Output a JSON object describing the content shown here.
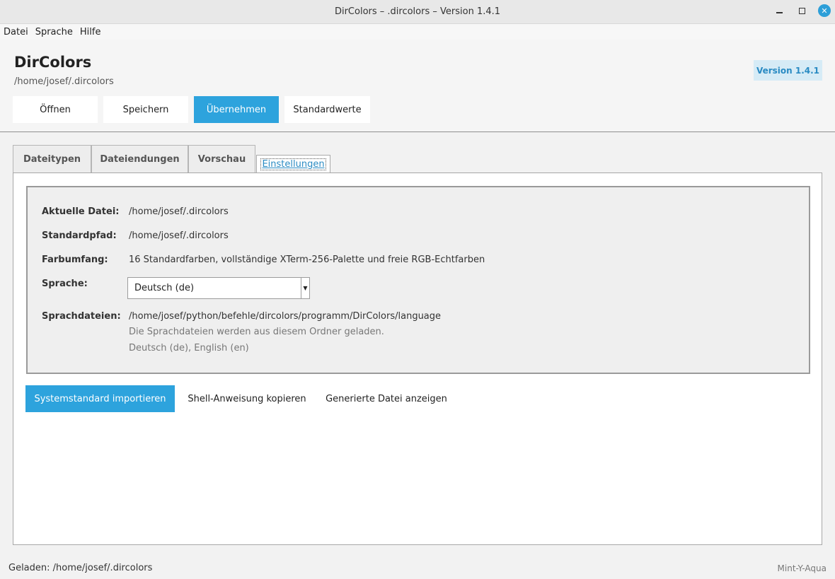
{
  "window": {
    "title": "DirColors – .dircolors – Version 1.4.1",
    "minimize_icon": "minimize-icon",
    "maximize_icon": "maximize-icon",
    "close_icon": "close-icon",
    "close_glyph": "✕"
  },
  "menubar": {
    "items": [
      "Datei",
      "Sprache",
      "Hilfe"
    ]
  },
  "header": {
    "app_title": "DirColors",
    "path": "/home/josef/.dircolors",
    "version_badge": "Version 1.4.1",
    "buttons": {
      "open": "Öffnen",
      "save": "Speichern",
      "apply": "Übernehmen",
      "defaults": "Standardwerte"
    }
  },
  "tabs": [
    {
      "label": "Dateitypen",
      "active": false
    },
    {
      "label": "Dateiendungen",
      "active": false
    },
    {
      "label": "Vorschau",
      "active": false
    },
    {
      "label": "Einstellungen",
      "active": true
    }
  ],
  "settings": {
    "current_file_label": "Aktuelle Datei:",
    "current_file_value": "/home/josef/.dircolors",
    "default_path_label": "Standardpfad:",
    "default_path_value": "/home/josef/.dircolors",
    "color_range_label": "Farbumfang:",
    "color_range_value": "16 Standardfarben, vollständige XTerm-256-Palette und freie RGB-Echtfarben",
    "language_label": "Sprache:",
    "language_selected": "Deutsch (de)",
    "language_arrow": "▼",
    "language_files_label": "Sprachdateien:",
    "language_files_value": "/home/josef/python/befehle/dircolors/programm/DirColors/language",
    "language_files_hint": "Die Sprachdateien werden aus diesem Ordner geladen.",
    "language_files_available": "Deutsch (de), English (en)"
  },
  "actions": {
    "import_system": "Systemstandard importieren",
    "copy_shell": "Shell-Anweisung kopieren",
    "show_generated": "Generierte Datei anzeigen"
  },
  "statusbar": {
    "loaded": "Geladen: /home/josef/.dircolors",
    "theme": "Mint-Y-Aqua"
  },
  "colors": {
    "accent": "#2da3dd",
    "accent_text": "#2a8bc3",
    "badge_bg": "#d6ebf6"
  }
}
